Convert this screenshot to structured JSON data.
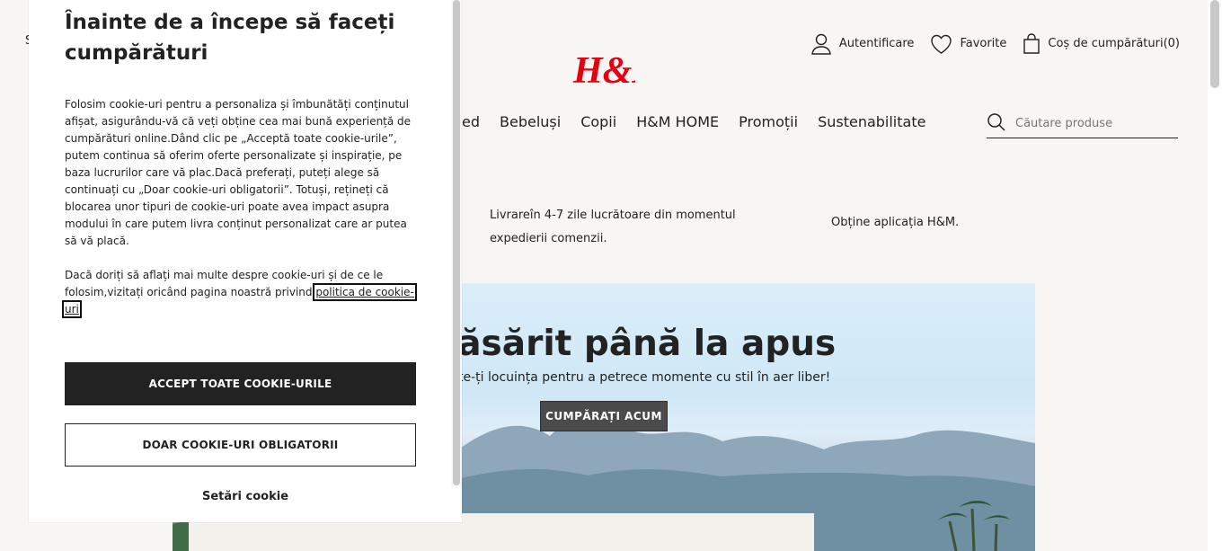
{
  "header": {
    "skip_link": "S",
    "brand": "H&M",
    "actions": [
      {
        "label": "Autentificare",
        "icon": "user-icon"
      },
      {
        "label": "Favorite",
        "icon": "heart-icon"
      },
      {
        "label": "Coș de cumpărături(0)",
        "icon": "shopping-bag-icon"
      }
    ],
    "nav": [
      "ed",
      "Bebeluși",
      "Copii",
      "H&M HOME",
      "Promoții",
      "Sustenabilitate"
    ],
    "search": {
      "placeholder": "Căutare produse",
      "value": "",
      "icon": "search-icon"
    }
  },
  "info_bar": {
    "delivery": "Livrareîn 4-7 zile lucrătoare din momentul expedierii comenzii.",
    "app": "Obține aplicația H&M."
  },
  "hero": {
    "title": "răsărit până la apus",
    "subtitle": "te-ți locuința pentru a petrece momente cu stil în aer liber!",
    "cta": "CUMPĂRAȚI ACUM"
  },
  "cookie_modal": {
    "title": "Înainte de a începe să faceți cumpărături",
    "paragraph1": "Folosim cookie-uri pentru a personaliza și îmbunătăți conținutul afișat, asigurându-vă că veți obține cea mai bună experiență de cumpărături online.Dând clic pe „Acceptă toate cookie-urile”, putem continua să oferim oferte personalizate și inspirație, pe baza lucrurilor care vă plac.Dacă preferați, puteți alege să continuați cu „Doar cookie-uri obligatorii”. Totuși, rețineți că blocarea unor tipuri de cookie-uri poate avea impact asupra modului în care putem livra conținut personalizat care ar putea să vă placă.",
    "paragraph2_prefix": "Dacă doriți să aflați mai multe despre cookie-uri și de ce le folosim,vizitați oricând pagina noastră privind ",
    "policy_link": "politica de cookie-uri",
    "accept_button": "ACCEPT TOATE COOKIE-URILE",
    "required_button": "DOAR COOKIE-URI OBLIGATORII",
    "settings_link": "Setări cookie"
  },
  "colors": {
    "brand": "#e50010",
    "page_background": "#f8f6f4",
    "button_dark": "#222222",
    "hero_button": "#4b4b4b"
  }
}
